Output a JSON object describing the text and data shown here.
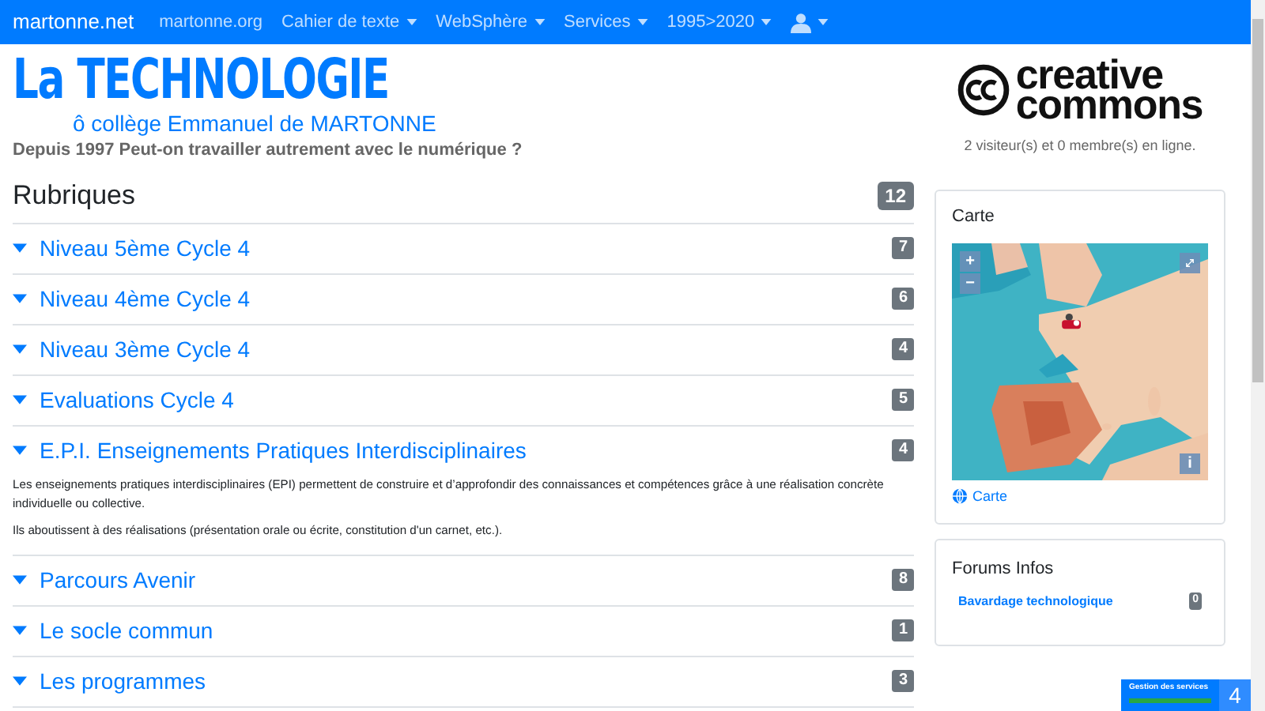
{
  "navbar": {
    "brand": "martonne.net",
    "items": [
      {
        "label": "martonne.org",
        "dropdown": false
      },
      {
        "label": "Cahier de texte",
        "dropdown": true
      },
      {
        "label": "WebSphère",
        "dropdown": true
      },
      {
        "label": "Services",
        "dropdown": true
      },
      {
        "label": "1995>2020",
        "dropdown": true
      }
    ],
    "user_menu": {
      "dropdown": true
    }
  },
  "header": {
    "title": "La TECHNOLOGIE",
    "subtitle": "ô collège Emmanuel de MARTONNE",
    "tagline": "Depuis 1997 Peut-on travailler autrement avec le numérique ?",
    "logo_lines": [
      "creative",
      "commons"
    ],
    "visitors": "2 visiteur(s) et 0 membre(s) en ligne."
  },
  "rubriques": {
    "title": "Rubriques",
    "count": "12",
    "items": [
      {
        "label": "Niveau 5ème Cycle 4",
        "count": "7"
      },
      {
        "label": "Niveau 4ème Cycle 4",
        "count": "6"
      },
      {
        "label": "Niveau 3ème Cycle 4",
        "count": "4"
      },
      {
        "label": "Evaluations Cycle 4",
        "count": "5"
      },
      {
        "label": "E.P.I. Enseignements Pratiques Interdisciplinaires",
        "count": "4",
        "paragraphs": [
          "Les enseignements pratiques interdisciplinaires (EPI) permettent de construire et d’approfondir des connaissances et compétences grâce à une réalisation concrète individuelle ou collective.",
          "Ils aboutissent à des réalisations (présentation orale ou écrite, constitution d'un carnet, etc.)."
        ]
      },
      {
        "label": "Parcours Avenir",
        "count": "8"
      },
      {
        "label": "Le socle commun",
        "count": "1"
      },
      {
        "label": "Les programmes",
        "count": "3"
      }
    ]
  },
  "map_card": {
    "title": "Carte",
    "zoom_in": "+",
    "zoom_out": "−",
    "info": "i",
    "link": "Carte"
  },
  "forums": {
    "title": "Forums Infos",
    "items": [
      {
        "label": "Bavardage technologique",
        "count": "0"
      }
    ]
  },
  "services_widget": {
    "label": "Gestion des services",
    "count": "4",
    "level": 1
  }
}
